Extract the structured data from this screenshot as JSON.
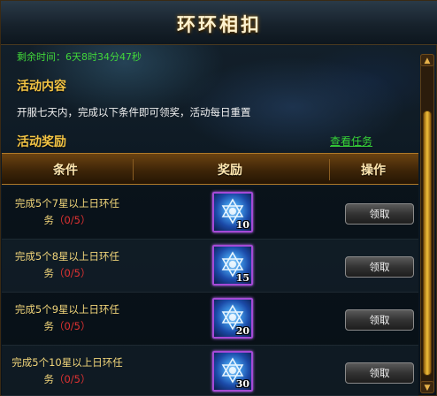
{
  "title": "环环相扣",
  "timer_text": "剩余时间：6天8时34分47秒",
  "section_content": "活动内容",
  "description": "开服七天内，完成以下条件即可领奖，活动每日重置",
  "section_reward": "活动奖励",
  "view_tasks_link": "查看任务",
  "table": {
    "headers": [
      "条件",
      "奖励",
      "操作"
    ],
    "rows": [
      {
        "condition_line1": "完成5个7星以上日环任",
        "condition_line2": "务",
        "progress": "（0/5）",
        "reward_count": "10",
        "button": "领取"
      },
      {
        "condition_line1": "完成5个8星以上日环任",
        "condition_line2": "务",
        "progress": "（0/5）",
        "reward_count": "15",
        "button": "领取"
      },
      {
        "condition_line1": "完成5个9星以上日环任",
        "condition_line2": "务",
        "progress": "（0/5）",
        "reward_count": "20",
        "button": "领取"
      },
      {
        "condition_line1": "完成5个10星以上日环任",
        "condition_line2": "务",
        "progress": "（0/5）",
        "reward_count": "30",
        "button": "领取"
      }
    ]
  },
  "icons": {
    "reward_item": "blue-star-gem-icon",
    "scroll_up": "chevron-up-icon",
    "scroll_down": "chevron-down-icon"
  },
  "colors": {
    "title_text": "#fff3d0",
    "section_heading": "#f3c445",
    "timer_text": "#41d63a",
    "link": "#37d437",
    "progress": "#e03232",
    "condition_text": "#f1d57a",
    "reward_border": "#a54ad6"
  }
}
